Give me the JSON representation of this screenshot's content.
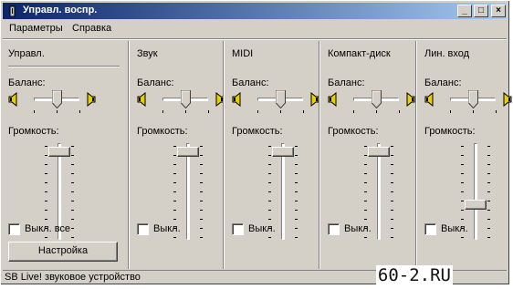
{
  "window": {
    "title": "Управл. воспр.",
    "minimize_glyph": "_",
    "maximize_glyph": "□",
    "close_glyph": "×"
  },
  "menu": {
    "items": [
      "Параметры",
      "Справка"
    ]
  },
  "labels": {
    "balance": "Баланс:",
    "volume": "Громкость:"
  },
  "master": {
    "title": "Управл.",
    "mute_label": "Выкл. все",
    "mute_checked": false,
    "settings_button": "Настройка",
    "volume_level": 0.96,
    "balance_level": 0.5
  },
  "channels": [
    {
      "title": "Звук",
      "mute_label": "Выкл.",
      "mute_checked": false,
      "volume_level": 0.96,
      "balance_level": 0.5
    },
    {
      "title": "MIDI",
      "mute_label": "Выкл.",
      "mute_checked": false,
      "volume_level": 0.96,
      "balance_level": 0.5
    },
    {
      "title": "Компакт-диск",
      "mute_label": "Выкл.",
      "mute_checked": false,
      "volume_level": 0.96,
      "balance_level": 0.5
    },
    {
      "title": "Лин. вход",
      "mute_label": "Выкл.",
      "mute_checked": false,
      "volume_level": 0.35,
      "balance_level": 0.5
    }
  ],
  "status": {
    "text": "SB Live! звуковое устройство"
  },
  "watermark": "60-2.RU",
  "colors": {
    "face": "#d4d0c8",
    "title_start": "#0a246a",
    "title_end": "#a6caf0",
    "speaker": "#e8d000"
  }
}
